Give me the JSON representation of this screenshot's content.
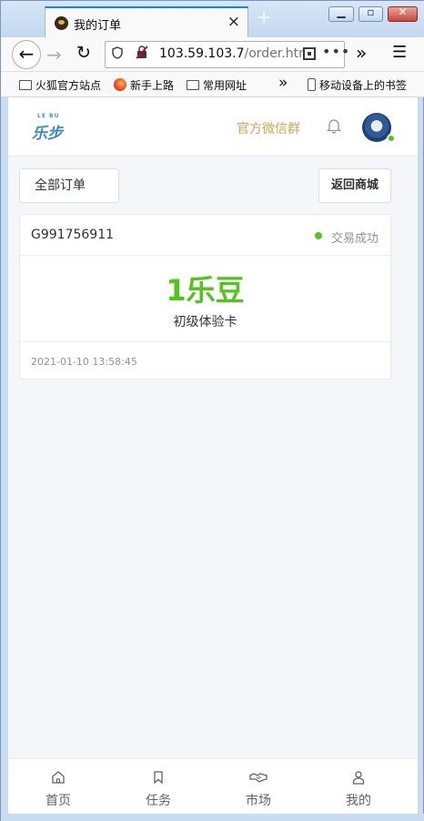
{
  "browser": {
    "tab_title": "我的订单",
    "new_tab": "+",
    "tab_close": "×",
    "url_host": "103.59.103.7",
    "url_path": "/order.htm",
    "url_more": "•••",
    "overflow": "»",
    "menu": "☰",
    "back": "←",
    "forward": "→",
    "reload": "↻",
    "window_min": "▁",
    "window_max": "▫",
    "window_close": "✕",
    "bookmarks": [
      {
        "label": "火狐官方站点",
        "icon": "folder-icon"
      },
      {
        "label": "新手上路",
        "icon": "firefox-icon"
      },
      {
        "label": "常用网址",
        "icon": "folder-icon"
      },
      {
        "label": "移动设备上的书签",
        "icon": "mobile-icon"
      }
    ],
    "bookmarks_chevron": "»"
  },
  "header": {
    "logo_small": "LE BU",
    "logo_text": "乐步",
    "wechat_group": "官方微信群"
  },
  "toolbar": {
    "all_orders": "全部订单",
    "back_to_mall": "返回商城"
  },
  "order": {
    "number": "G991756911",
    "status": "交易成功",
    "status_color": "#52c41a",
    "price": "1乐豆",
    "product": "初级体验卡",
    "time": "2021-01-10 13:58:45"
  },
  "tabbar": {
    "items": [
      {
        "label": "首页",
        "icon": "home-icon"
      },
      {
        "label": "任务",
        "icon": "bookmark-icon"
      },
      {
        "label": "市场",
        "icon": "handshake-icon"
      },
      {
        "label": "我的",
        "icon": "user-icon"
      }
    ]
  },
  "colors": {
    "accent_green": "#52c41a",
    "wechat_gold": "#c9a654",
    "logo_blue": "#3a86cf"
  }
}
